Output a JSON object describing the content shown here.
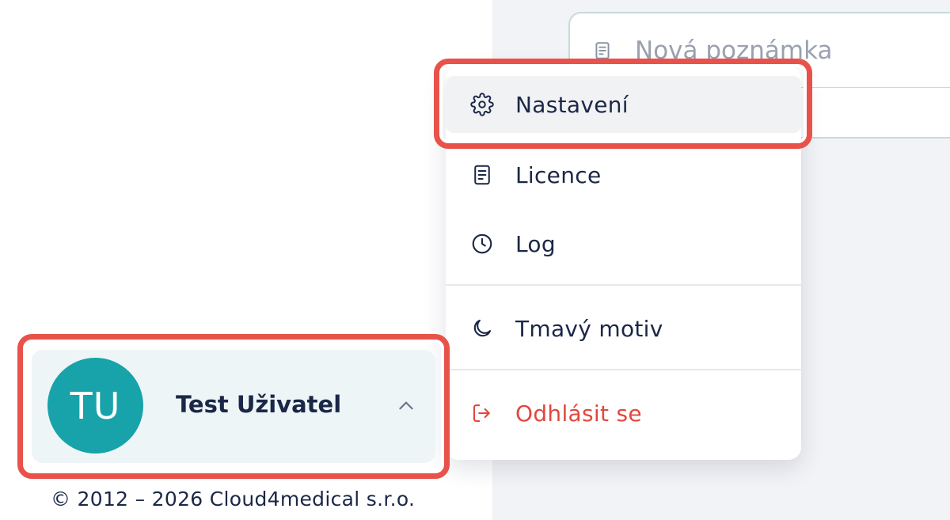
{
  "note": {
    "placeholder": "Nová poznámka",
    "icon": "document-icon"
  },
  "menu": {
    "items": [
      {
        "label": "Nastavení",
        "icon": "gear-icon",
        "highlighted": true
      },
      {
        "label": "Licence",
        "icon": "document-icon"
      },
      {
        "label": "Log",
        "icon": "clock-icon"
      },
      {
        "label": "Tmavý motiv",
        "icon": "moon-icon"
      },
      {
        "label": "Odhlásit se",
        "icon": "logout-icon",
        "color": "#e2473e"
      }
    ]
  },
  "user": {
    "initials": "TU",
    "name": "Test Uživatel",
    "avatar_color": "#17a3a9",
    "expanded": true
  },
  "footer": {
    "copyright": "© 2012 – 2026 Cloud4medical s.r.o."
  },
  "colors": {
    "accent": "#17a3a9",
    "danger": "#e2473e",
    "highlight": "#e8524a",
    "text": "#1b2747"
  }
}
